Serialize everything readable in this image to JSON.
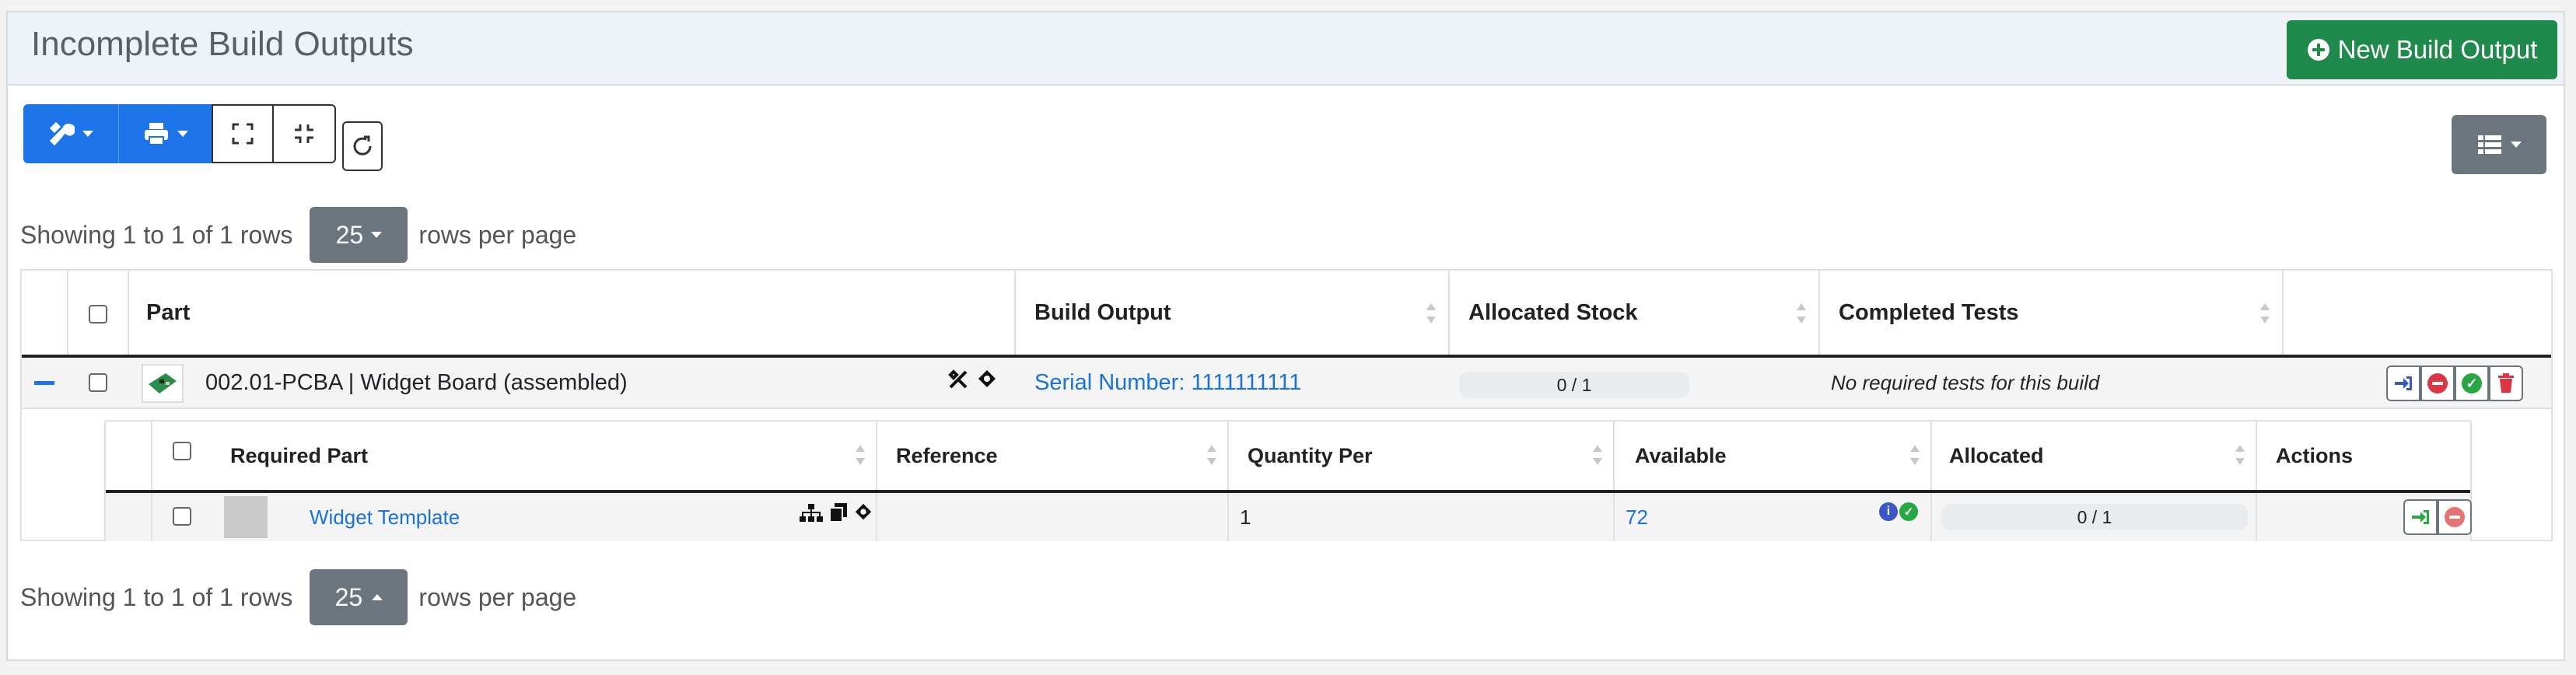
{
  "panel": {
    "title": "Incomplete Build Outputs",
    "new_output_label": "New Build Output"
  },
  "pagination_top": {
    "text_before": "Showing 1 to 1 of 1 rows",
    "page_size": "25",
    "text_after": "rows per page"
  },
  "pagination_bottom": {
    "text_before": "Showing 1 to 1 of 1 rows",
    "page_size": "25",
    "text_after": "rows per page"
  },
  "outputs_table": {
    "columns": [
      "Part",
      "Build Output",
      "Allocated Stock",
      "Completed Tests"
    ],
    "row": {
      "part": "002.01-PCBA | Widget Board (assembled)",
      "build_output": "Serial Number: 1111111111",
      "allocated_stock": "0 / 1",
      "completed_tests": "No required tests for this build"
    }
  },
  "sub_table": {
    "columns": [
      "Required Part",
      "Reference",
      "Quantity Per",
      "Available",
      "Allocated",
      "Actions"
    ],
    "row": {
      "required_part": "Widget Template",
      "reference": "",
      "quantity_per": "1",
      "available": "72",
      "allocated": "0 / 1"
    }
  },
  "colors": {
    "primary": "#1c74e8",
    "success": "#1f8a4c",
    "secondary": "#6c757d",
    "link": "#1a73d9",
    "danger": "#dc3545"
  },
  "icons": [
    "tools-icon",
    "print-icon",
    "expand-icon",
    "collapse-icon",
    "refresh-icon",
    "columns-icon",
    "plus-circle-icon",
    "minus-icon",
    "info-icon",
    "check-icon",
    "sitemap-icon",
    "copy-icon",
    "tag-icon",
    "allocate-icon",
    "deallocate-icon",
    "complete-icon",
    "delete-icon"
  ]
}
